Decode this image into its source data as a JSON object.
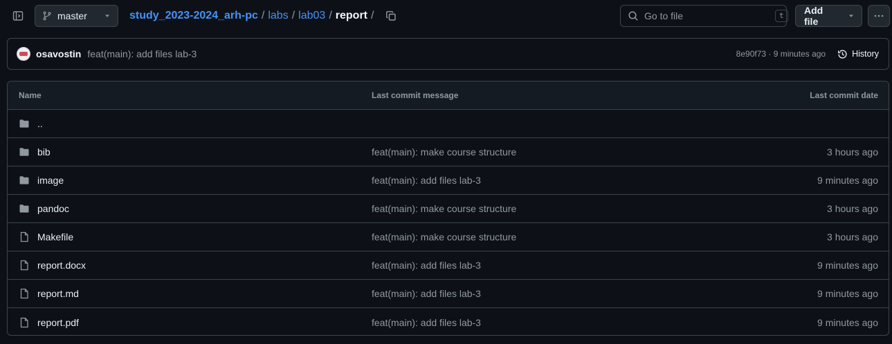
{
  "branch": {
    "name": "master"
  },
  "breadcrumb": {
    "repo": "study_2023-2024_arh-pc",
    "parts": [
      "labs",
      "lab03"
    ],
    "current": "report",
    "separator": "/"
  },
  "search": {
    "placeholder": "Go to file",
    "shortcut": "t"
  },
  "actions": {
    "add_file": "Add file"
  },
  "commit": {
    "author": "osavostin",
    "message": "feat(main): add files lab-3",
    "meta": "8e90f73 · 9 minutes ago",
    "history_label": "History"
  },
  "table": {
    "headers": {
      "name": "Name",
      "message": "Last commit message",
      "date": "Last commit date"
    },
    "parent": "..",
    "rows": [
      {
        "type": "folder",
        "name": "bib",
        "message": "feat(main): make course structure",
        "date": "3 hours ago"
      },
      {
        "type": "folder",
        "name": "image",
        "message": "feat(main): add files lab-3",
        "date": "9 minutes ago"
      },
      {
        "type": "folder",
        "name": "pandoc",
        "message": "feat(main): make course structure",
        "date": "3 hours ago"
      },
      {
        "type": "file",
        "name": "Makefile",
        "message": "feat(main): make course structure",
        "date": "3 hours ago"
      },
      {
        "type": "file",
        "name": "report.docx",
        "message": "feat(main): add files lab-3",
        "date": "9 minutes ago"
      },
      {
        "type": "file",
        "name": "report.md",
        "message": "feat(main): add files lab-3",
        "date": "9 minutes ago"
      },
      {
        "type": "file",
        "name": "report.pdf",
        "message": "feat(main): add files lab-3",
        "date": "9 minutes ago"
      }
    ]
  },
  "icons": {
    "sidebar_toggle": "sidebar-expand-icon",
    "branch": "git-branch-icon",
    "caret": "triangle-down-icon",
    "copy": "copy-icon",
    "search": "search-icon",
    "more": "kebab-horizontal-icon",
    "history": "history-icon",
    "folder": "folder-icon",
    "file": "file-icon"
  },
  "colors": {
    "background": "#0d1117",
    "link": "#4493f8",
    "border": "#3d444d",
    "muted": "#9198a1",
    "header_bg": "#151b23"
  }
}
